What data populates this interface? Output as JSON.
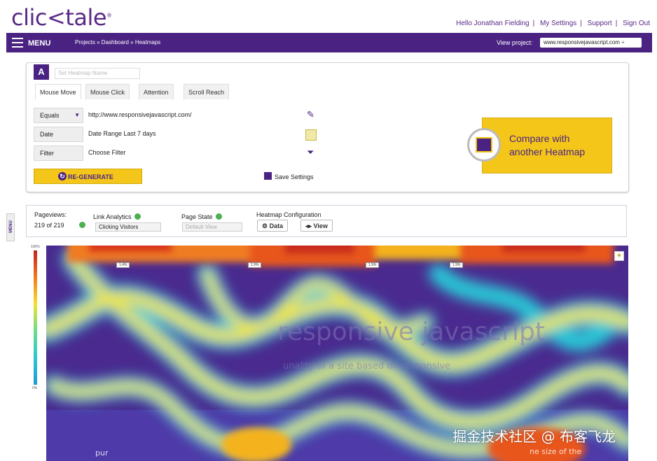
{
  "header": {
    "logo_text": "clic<tale",
    "nav": [
      "Hello Jonathan Fielding",
      "My Settings",
      "Support",
      "Sign Out"
    ]
  },
  "menubar": {
    "menu_label": "MENU",
    "breadcrumb": "Projects » Dashboard » Heatmaps",
    "view_project_label": "View project:",
    "project_value": "www.responsivejavascript.com ÷"
  },
  "side_tab": "MENU",
  "panel": {
    "badge": "A",
    "name_placeholder": "Set Heatmap Name",
    "tabs": [
      "Mouse Move",
      "Mouse Click",
      "Attention",
      "Scroll Reach"
    ],
    "rows": [
      {
        "label": "Equals",
        "value": "http://www.responsivejavascript.com/"
      },
      {
        "label": "Date",
        "value": "Date Range Last 7 days"
      },
      {
        "label": "Filter",
        "value": "Choose Filter"
      }
    ],
    "regenerate_label": "RE-GENERATE",
    "save_label": "Save Settings",
    "compare_line1": "Compare with",
    "compare_line2": "another Heatmap"
  },
  "toolbar": {
    "pageviews_label": "Pageviews:",
    "pageviews_value": "219 of 219",
    "link_analytics_label": "Link Analytics",
    "link_analytics_value": "Clicking Visitors",
    "page_state_label": "Page State",
    "page_state_value": "Default View",
    "config_label": "Heatmap Configuration",
    "data_button": "Data",
    "view_button": "View"
  },
  "heatmap": {
    "scale_top": "100%",
    "scale_bottom": "0%",
    "overlay_title": "responsive javascript",
    "overlay_subtitle": "unality of a site based on responsive",
    "overlay_bottom_left": "pur",
    "overlay_bottom_right": "ne size of the",
    "percent_labels": [
      "1.4%",
      "1.9%",
      "1.9%",
      "1.9%"
    ],
    "watermark": "掘金技术社区 @ 布客飞龙"
  },
  "colors": {
    "brand": "#4a2382",
    "accent": "#f4c61a"
  }
}
